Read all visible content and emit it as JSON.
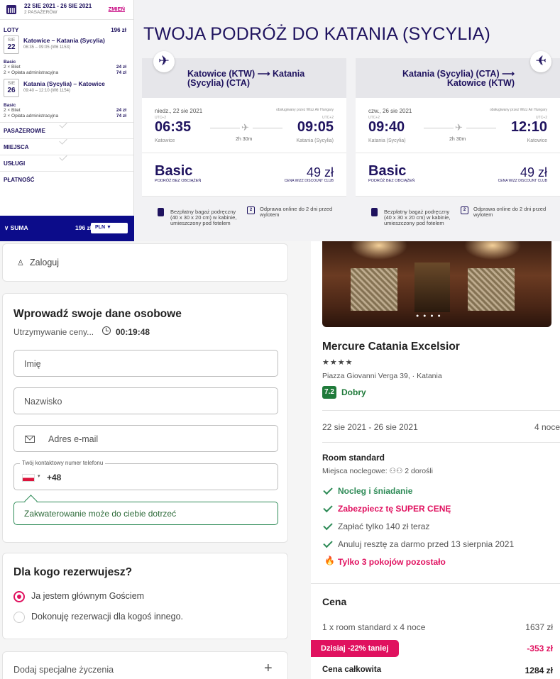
{
  "wizz": {
    "dates": "22 SIE 2021 - 26 SIE 2021",
    "passengers": "2 PASAŻERÓW",
    "change": "ZMIEŃ",
    "flights_label": "LOTY",
    "flights_total": "196 zł",
    "legs": [
      {
        "month": "SIE",
        "day": "22",
        "title": "Katowice – Katania (Sycylia)",
        "sub": "06:35 – 09:05 (W6 1153)",
        "fare": "Basic",
        "bilet": "2 × Bilet",
        "bilet_amt": "24 zł",
        "oplata": "2 × Opłata administracyjna",
        "oplata_amt": "74 zł"
      },
      {
        "month": "SIE",
        "day": "26",
        "title": "Katania (Sycylia) – Katowice",
        "sub": "09:40 – 12:10 (W6 1154)",
        "fare": "Basic",
        "bilet": "2 × Bilet",
        "bilet_amt": "24 zł",
        "oplata": "2 × Opłata administracyjna",
        "oplata_amt": "74 zł"
      }
    ],
    "sections": [
      "PASAŻEROWIE",
      "MIEJSCA",
      "USŁUGI",
      "PŁATNOŚĆ"
    ],
    "suma_label": "∨ SUMA",
    "suma_amt": "196 zł",
    "currency": "PLN ▼",
    "title": "TWOJA PODRÓŻ DO KATANIA (SYCYLIA)",
    "cards": [
      {
        "route_l1": "Katowice (KTW) ⟶ Katania",
        "route_l2": "(Sycylia) (CTA)",
        "plane": "✈",
        "day": "niedz., 22 sie 2021",
        "operated": "obsługiwany przez Wizz Air Hungary",
        "utc_dep": "UTC+2",
        "utc_arr": "UTC+2",
        "dep": "06:35",
        "arr": "09:05",
        "dur": "2h 30m",
        "plane_mid": "✈",
        "city_dep": "Katowice",
        "city_arr": "Katania (Sycylia)",
        "fare": "Basic",
        "fare_sub": "PODRÓŻ BEZ OBCIĄŻEŃ",
        "price": "49 zł",
        "club": "CENA WIZZ DISCOUNT CLUB",
        "b1": "Bezpłatny bagaż podręczny (40 x 30 x 20 cm) w kabinie, umieszczony pod fotelem",
        "b2": "Odprawa online do 2 dni przed wylotem",
        "cal_num": "2"
      },
      {
        "route_l1": "Katania (Sycylia) (CTA) ⟶",
        "route_l2": "Katowice (KTW)",
        "plane": "✈",
        "day": "czw., 26 sie 2021",
        "operated": "obsługiwany przez Wizz Air Hungary",
        "utc_dep": "UTC+2",
        "utc_arr": "UTC+2",
        "dep": "09:40",
        "arr": "12:10",
        "dur": "2h 30m",
        "plane_mid": "✈",
        "city_dep": "Katania (Sycylia)",
        "city_arr": "Katowice",
        "fare": "Basic",
        "fare_sub": "PODRÓŻ BEZ OBCIĄŻEŃ",
        "price": "49 zł",
        "club": "CENA WIZZ DISCOUNT CLUB",
        "b1": "Bezpłatny bagaż podręczny (40 x 30 x 20 cm) w kabinie, umieszczony pod fotelem",
        "b2": "Odprawa online do 2 dni przed wylotem",
        "cal_num": "2"
      }
    ]
  },
  "booking": {
    "login": "Zaloguj",
    "user_icon": "♙",
    "personal_title": "Wprowadź swoje dane osobowe",
    "hold": "Utrzymywanie ceny...",
    "timer": "00:19:48",
    "first_name_ph": "Imię",
    "last_name_ph": "Nazwisko",
    "email_ph": "Adres e-mail",
    "phone_legend": "Twój kontaktowy numer telefonu",
    "phone_caret": "▾",
    "phone_code": "+48",
    "tip": "Zakwaterowanie może do ciebie dotrzeć",
    "forwho_title": "Dla kogo rezerwujesz?",
    "opt1": "Ja jestem głównym Gościem",
    "opt2": "Dokonuję rezerwacji dla kogoś innego.",
    "special": "Dodaj specjalne życzenia",
    "plus": "+"
  },
  "hotel": {
    "photo_dots": "● ● ● ●",
    "name": "Mercure Catania Excelsior",
    "stars": "★★★★",
    "address": "Piazza Giovanni Verga 39, · Katania",
    "rating": "7.2",
    "rating_text": "Dobry",
    "dates": "22 sie 2021 - 26 sie 2021",
    "nights": "4 noce",
    "room": "Room standard",
    "beds": "Miejsca noclegowe:  ⚇⚇  2 dorośli",
    "features": [
      {
        "text": "Nocleg i śniadanie",
        "color": "#2e8b57",
        "bold": true
      },
      {
        "text": "Zabezpiecz tę SUPER CENĘ",
        "color": "#e0115f",
        "bold": true
      },
      {
        "text": "Zapłać tylko 140 zł teraz",
        "color": "#555555",
        "bold": false
      },
      {
        "text": "Anuluj resztę za darmo przed 13 sierpnia 2021",
        "color": "#555555",
        "bold": false
      }
    ],
    "flame_icon": "🔥",
    "scarcity": "Tylko 3 pokojów pozostało",
    "price_title": "Cena",
    "price_line": "1 x room standard x 4 noce",
    "price_line_val": "1637 zł",
    "discount": "Dzisiaj -22% taniej",
    "discount_val": "-353 zł",
    "total_label": "Cena całkowita",
    "total_val": "1284 zł"
  }
}
